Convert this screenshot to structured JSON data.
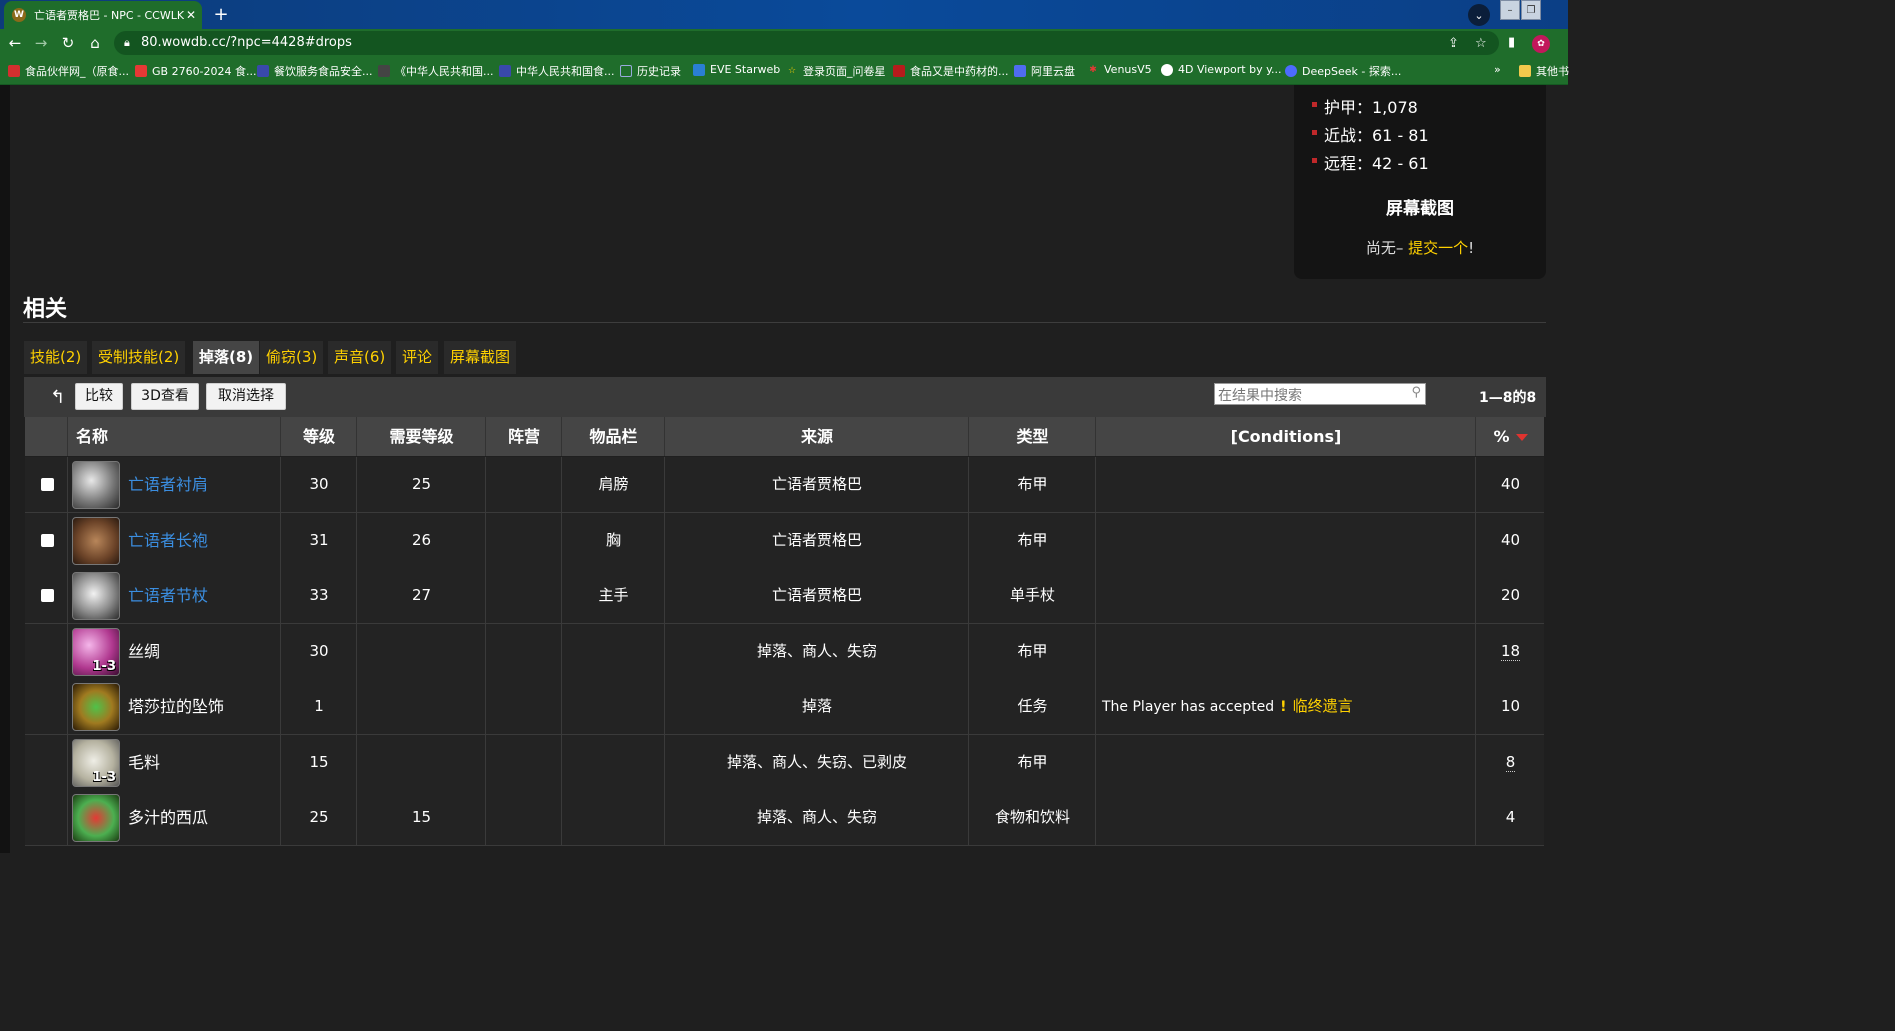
{
  "browser": {
    "tab_title": "亡语者贾格巴 - NPC - CCWLK怀",
    "url": "80.wowdb.cc/?npc=4428#drops",
    "bookmarks": [
      "食品伙伴网_（原食...",
      "GB 2760-2024 食...",
      "餐饮服务食品安全...",
      "《中华人民共和国...",
      "中华人民共和国食...",
      "历史记录",
      "EVE Starweb",
      "登录页面_问卷星",
      "食品又是中药材的...",
      "阿里云盘",
      "VenusV5",
      "4D Viewport by y...",
      "DeepSeek - 探索...",
      "其他书"
    ]
  },
  "infobox": {
    "stats": [
      "护甲：1,078",
      "近战：61 - 81",
      "远程：42 - 61"
    ],
    "screenshot_title": "屏幕截图",
    "screenshot_prefix": "尚无–",
    "screenshot_link": "提交一个",
    "screenshot_suffix": "!"
  },
  "related": {
    "title": "相关",
    "tabs": [
      "技能(2)",
      "受制技能(2)",
      "掉落(8)",
      "偷窃(3)",
      "声音(6)",
      "评论",
      "屏幕截图"
    ],
    "active_tab": "掉落(8)"
  },
  "toolbar": {
    "compare": "比较",
    "view3d": "3D查看",
    "deselect": "取消选择",
    "search_placeholder": "在结果中搜索",
    "count": "1—8的8"
  },
  "table": {
    "headers": [
      "名称",
      "等级",
      "需要等级",
      "阵营",
      "物品栏",
      "来源",
      "类型",
      "[Conditions]",
      "%"
    ],
    "rows": [
      {
        "name": "亡语者衬肩",
        "level": "30",
        "req": "25",
        "side": "",
        "slot": "肩膀",
        "source": "亡语者贾格巴",
        "type": "布甲",
        "cond_text": "",
        "cond_link": "",
        "pct": "40",
        "qty": "",
        "checkbox": true,
        "link": true
      },
      {
        "name": "亡语者长袍",
        "level": "31",
        "req": "26",
        "side": "",
        "slot": "胸",
        "source": "亡语者贾格巴",
        "type": "布甲",
        "cond_text": "",
        "cond_link": "",
        "pct": "40",
        "qty": "",
        "checkbox": true,
        "link": true
      },
      {
        "name": "亡语者节杖",
        "level": "33",
        "req": "27",
        "side": "",
        "slot": "主手",
        "source": "亡语者贾格巴",
        "type": "单手杖",
        "cond_text": "",
        "cond_link": "",
        "pct": "20",
        "qty": "",
        "checkbox": true,
        "link": true
      },
      {
        "name": "丝绸",
        "level": "30",
        "req": "",
        "side": "",
        "slot": "",
        "source": "掉落、商人、失窃",
        "type": "布甲",
        "cond_text": "",
        "cond_link": "",
        "pct": "18",
        "qty": "1-3",
        "checkbox": false,
        "link": false
      },
      {
        "name": "塔莎拉的坠饰",
        "level": "1",
        "req": "",
        "side": "",
        "slot": "",
        "source": "掉落",
        "type": "任务",
        "cond_text": "The Player has accepted",
        "cond_link": "临终遗言",
        "pct": "10",
        "qty": "",
        "checkbox": false,
        "link": false
      },
      {
        "name": "毛料",
        "level": "15",
        "req": "",
        "side": "",
        "slot": "",
        "source": "掉落、商人、失窃、已剥皮",
        "type": "布甲",
        "cond_text": "",
        "cond_link": "",
        "pct": "8",
        "qty": "1-3",
        "checkbox": false,
        "link": false
      },
      {
        "name": "多汁的西瓜",
        "level": "25",
        "req": "15",
        "side": "",
        "slot": "",
        "source": "掉落、商人、失窃",
        "type": "食物和饮料",
        "cond_text": "",
        "cond_link": "",
        "pct": "4",
        "qty": "",
        "checkbox": false,
        "link": false
      }
    ]
  },
  "colors": {
    "accent_link": "#ffd100",
    "item_link": "#3b8ee0",
    "chrome_green": "#1f6d2b"
  }
}
